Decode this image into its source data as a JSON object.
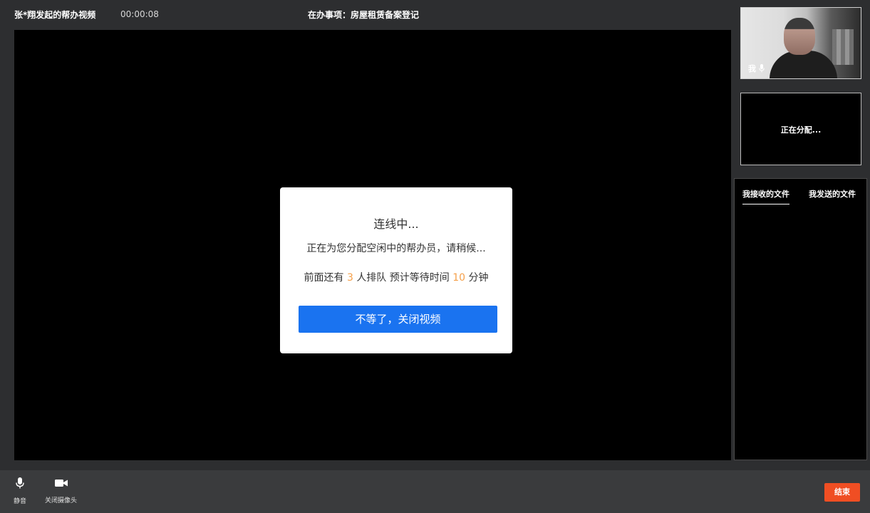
{
  "header": {
    "call_title": "张*翔发起的帮办视频",
    "timer": "00:00:08",
    "current_task": "在办事项：房屋租赁备案登记"
  },
  "dialog": {
    "title": "连线中...",
    "description": "正在为您分配空闲中的帮办员，请稍候...",
    "queue_prefix": "前面还有",
    "queue_count": "3",
    "queue_mid": "人排队 预计等待时间",
    "wait_minutes": "10",
    "queue_suffix": "分钟",
    "cancel_button": "不等了，关闭视频"
  },
  "self_preview": {
    "label": "我",
    "icon": "microphone-icon"
  },
  "assign_box": {
    "status": "正在分配..."
  },
  "files": {
    "tabs": [
      {
        "label": "我接收的文件",
        "active": true
      },
      {
        "label": "我发送的文件",
        "active": false
      }
    ]
  },
  "controls": {
    "mute_label": "静音",
    "mute_icon": "microphone-icon",
    "camera_label": "关闭摄像头",
    "camera_icon": "video-camera-icon",
    "end_label": "结束"
  },
  "colors": {
    "accent_blue": "#1a73f0",
    "end_red": "#f04e23",
    "highlight_orange": "#f5a04a"
  }
}
